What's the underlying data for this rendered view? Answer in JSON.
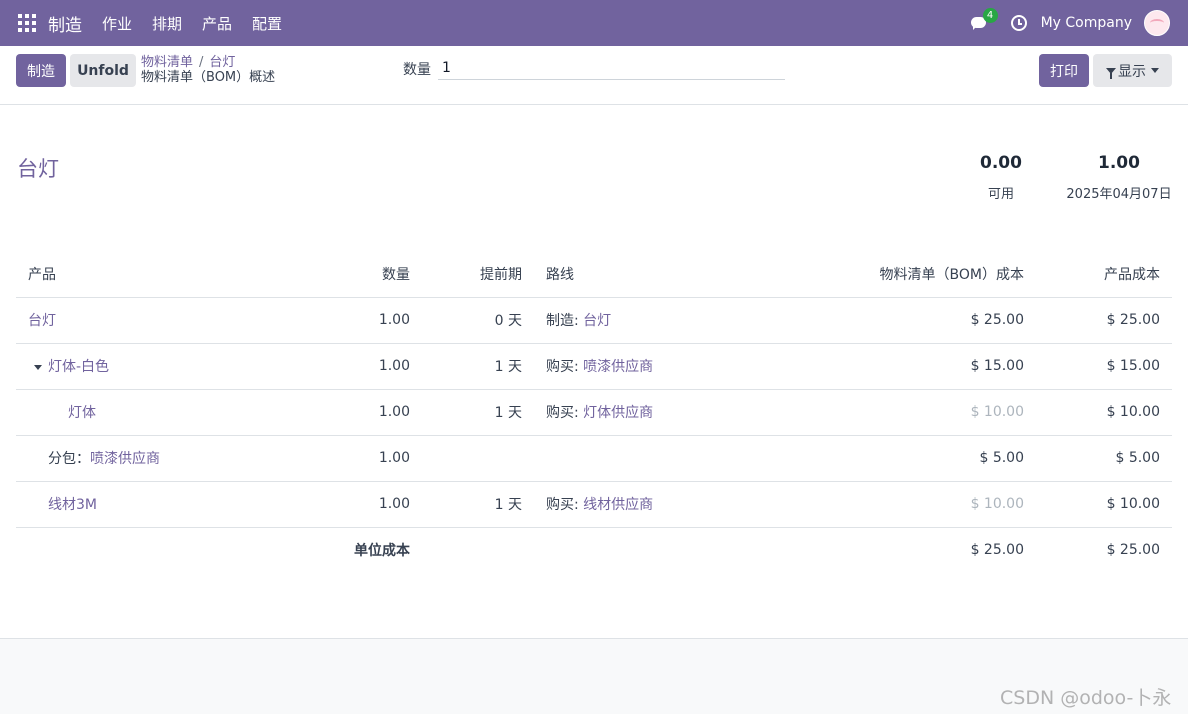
{
  "navbar": {
    "brand": "制造",
    "menu": [
      "作业",
      "排期",
      "产品",
      "配置"
    ],
    "chat_badge": "4",
    "company": "My Company"
  },
  "control": {
    "manufacture_btn": "制造",
    "unfold_btn": "Unfold",
    "breadcrumb": [
      "物料清单",
      "台灯"
    ],
    "subtitle": "物料清单（BOM）概述",
    "quantity_label": "数量",
    "quantity_value": "1",
    "print_btn": "打印",
    "display_btn": "显示"
  },
  "report": {
    "title": "台灯",
    "available_value": "0.00",
    "available_label": "可用",
    "date_value": "1.00",
    "date_label": "2025年04月07日",
    "columns": [
      "产品",
      "数量",
      "提前期",
      "路线",
      "物料清单（BOM）成本",
      "产品成本"
    ],
    "rows": [
      {
        "product": "台灯",
        "qty": "1.00",
        "lead": "0 天",
        "route_prefix": "制造: ",
        "route_link": "台灯",
        "bom_cost": "$ 25.00",
        "prod_cost": "$ 25.00"
      },
      {
        "product": "灯体-白色",
        "qty": "1.00",
        "lead": "1 天",
        "route_prefix": "购买: ",
        "route_link": "喷漆供应商",
        "bom_cost": "$ 15.00",
        "prod_cost": "$ 15.00"
      },
      {
        "product": "灯体",
        "qty": "1.00",
        "lead": "1 天",
        "route_prefix": "购买: ",
        "route_link": "灯体供应商",
        "bom_cost": "$ 10.00",
        "prod_cost": "$ 10.00"
      },
      {
        "product_prefix": "分包：",
        "product": "喷漆供应商",
        "qty": "1.00",
        "lead": "",
        "route_prefix": "",
        "route_link": "",
        "bom_cost": "$ 5.00",
        "prod_cost": "$ 5.00"
      },
      {
        "product": "线材3M",
        "qty": "1.00",
        "lead": "1 天",
        "route_prefix": "购买: ",
        "route_link": "线材供应商",
        "bom_cost": "$ 10.00",
        "prod_cost": "$ 10.00"
      }
    ],
    "total_label": "单位成本",
    "total_bom_cost": "$ 25.00",
    "total_prod_cost": "$ 25.00"
  },
  "watermark": "CSDN @odoo-卜永"
}
